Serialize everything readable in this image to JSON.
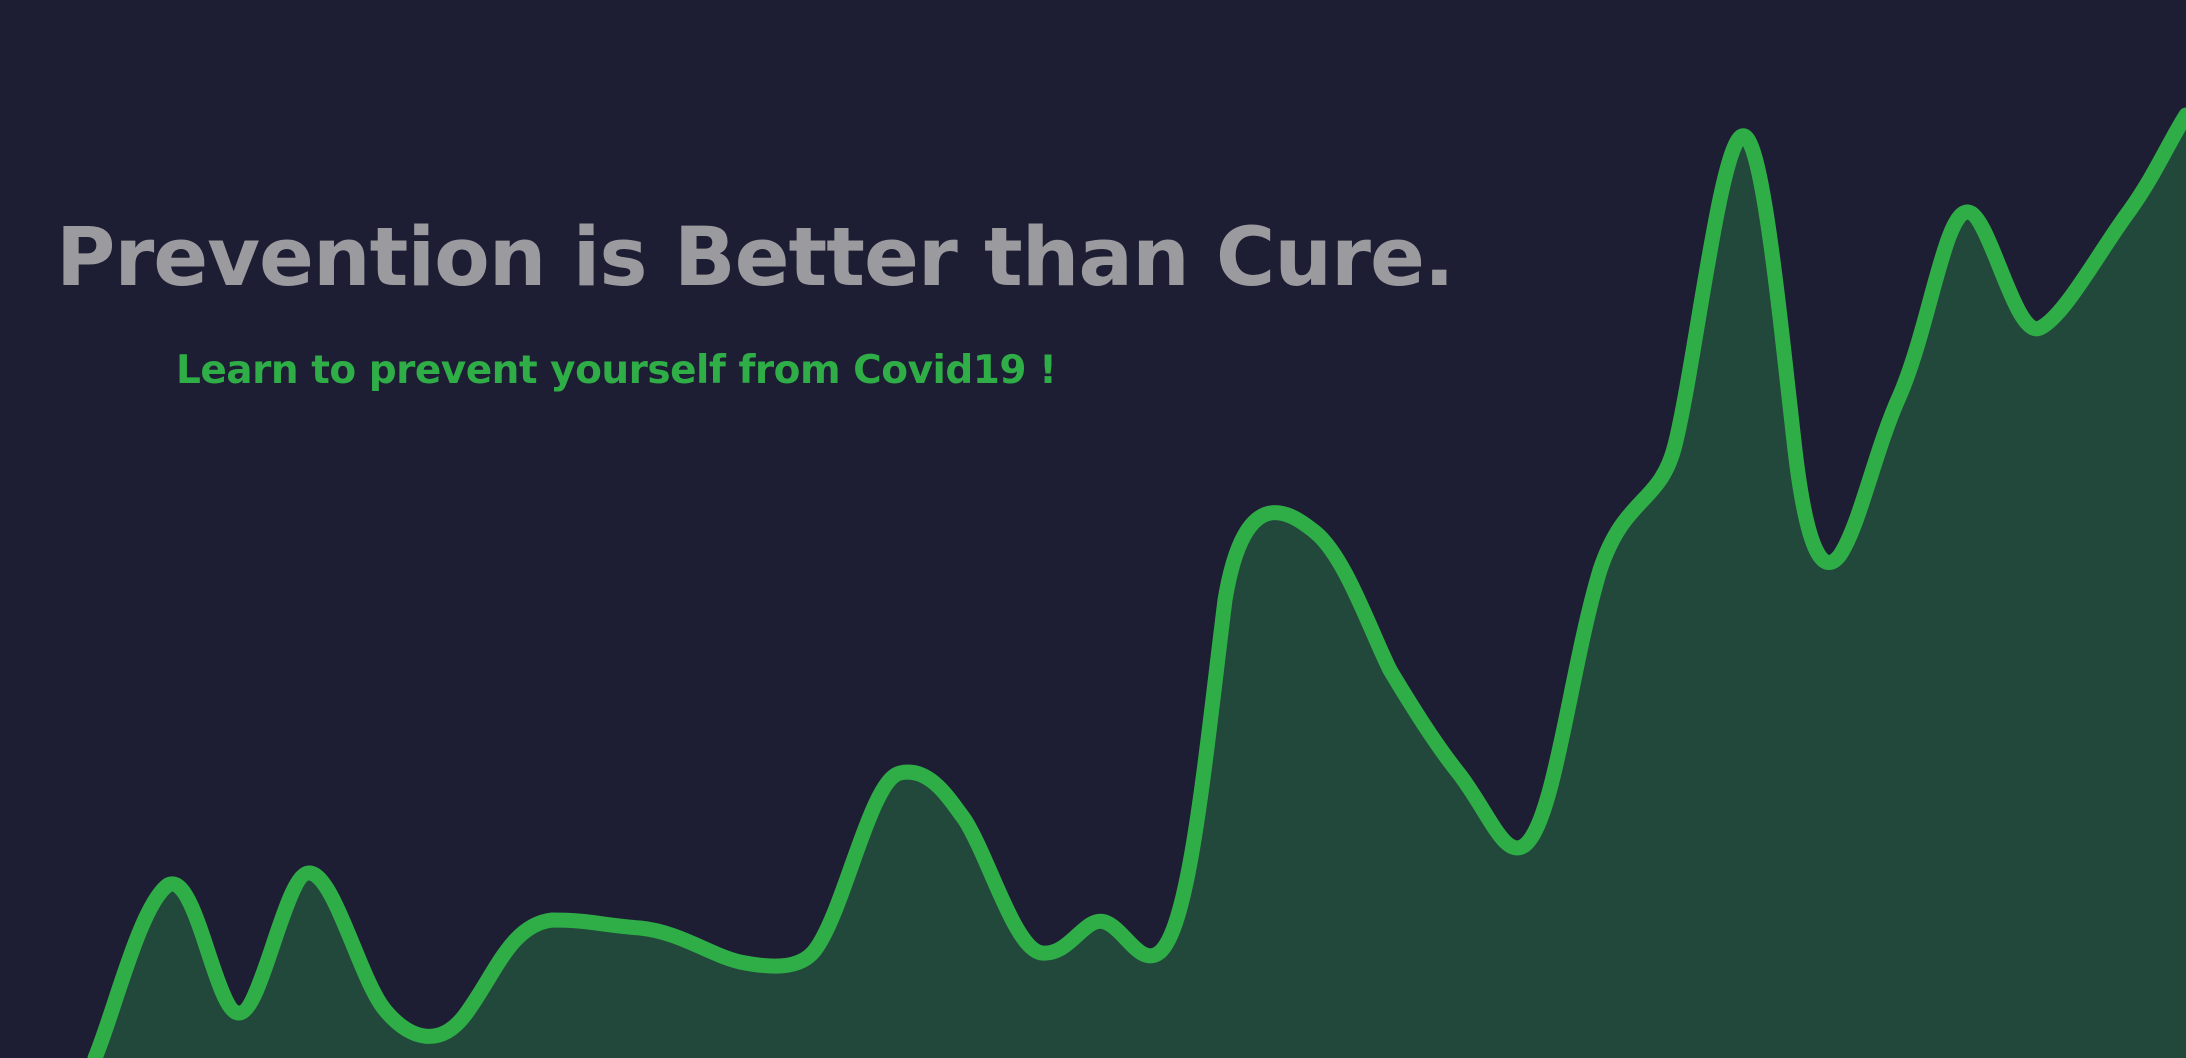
{
  "hero": {
    "headline": "Prevention is Better than Cure.",
    "tagline": "Learn to prevent yourself from Covid19 !"
  },
  "colors": {
    "background": "#1d1d33",
    "headline": "#9a9a9f",
    "accent_green": "#2fae47",
    "area_fill": "#21483a"
  },
  "decorative_wave": {
    "icon": "rising-wave-line"
  }
}
